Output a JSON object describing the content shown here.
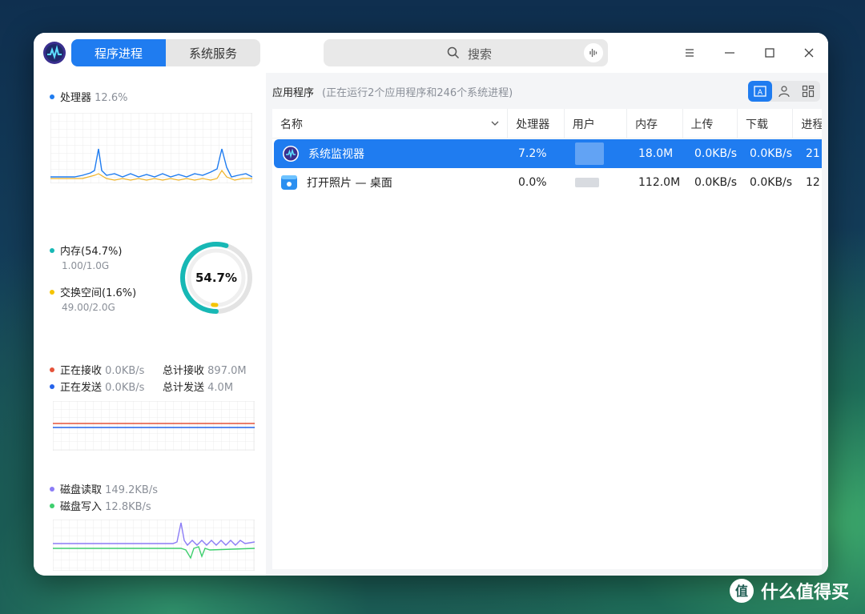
{
  "tabs": [
    {
      "label": "程序进程",
      "active": true
    },
    {
      "label": "系统服务",
      "active": false
    }
  ],
  "search": {
    "placeholder": "搜索"
  },
  "left": {
    "cpu": {
      "label": "处理器",
      "value": "12.6%",
      "color": "#1f7cf0"
    },
    "memory": {
      "label": "内存(54.7%)",
      "detail": "1.00/1.0G",
      "color": "#17b8b5"
    },
    "swap": {
      "label": "交换空间(1.6%)",
      "detail": "49.00/2.0G",
      "color": "#f5c400"
    },
    "gauge_text": "54.7%",
    "gauge_memory_fraction": 0.547,
    "gauge_swap_fraction": 0.016,
    "net": {
      "recv_label": "正在接收",
      "recv_value": "0.0KB/s",
      "send_label": "正在发送",
      "send_value": "0.0KB/s",
      "total_recv_label": "总计接收",
      "total_recv_value": "897.0M",
      "total_send_label": "总计发送",
      "total_send_value": "4.0M",
      "recv_color": "#e5533a",
      "send_color": "#2563eb"
    },
    "disk": {
      "read_label": "磁盘读取",
      "read_value": "149.2KB/s",
      "write_label": "磁盘写入",
      "write_value": "12.8KB/s",
      "read_color": "#8b7cf6",
      "write_color": "#3ecf6e"
    }
  },
  "right": {
    "title": "应用程序",
    "subtitle": "(正在运行2个应用程序和246个系统进程)",
    "columns": [
      "名称",
      "处理器",
      "用户",
      "内存",
      "上传",
      "下载",
      "进程"
    ],
    "rows": [
      {
        "name": "系统监视器",
        "cpu": "7.2%",
        "mem": "18.0M",
        "up": "0.0KB/s",
        "down": "0.0KB/s",
        "pid": "21",
        "selected": true
      },
      {
        "name": "打开照片 — 桌面",
        "cpu": "0.0%",
        "mem": "112.0M",
        "up": "0.0KB/s",
        "down": "0.0KB/s",
        "pid": "12",
        "selected": false
      }
    ]
  },
  "watermark": "什么值得买",
  "icons": [
    "app-logo-icon",
    "search-icon",
    "voice-icon",
    "menu-icon",
    "minimize-icon",
    "maximize-icon",
    "close-icon",
    "chevron-down-icon",
    "app-view-icon",
    "user-view-icon",
    "tree-view-icon",
    "system-monitor-icon",
    "photos-icon"
  ]
}
